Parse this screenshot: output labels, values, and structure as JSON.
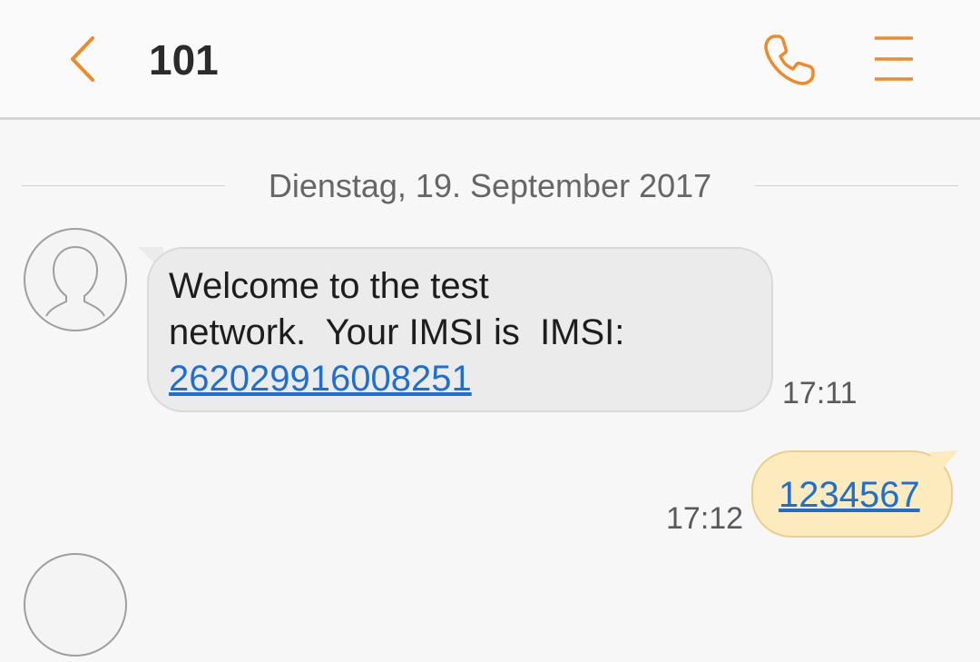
{
  "header": {
    "title": "101",
    "back_icon": "chevron-left-icon",
    "call_icon": "phone-icon",
    "menu_icon": "menu-icon",
    "accent_color": "#ef8a2b"
  },
  "conversation": {
    "date_divider": "Dienstag, 19. September 2017",
    "messages": [
      {
        "direction": "incoming",
        "text": "Welcome to the test\nnetwork.  Your IMSI is  IMSI:",
        "link": "262029916008251",
        "time": "17:11",
        "bubble_color": "#ebebeb"
      },
      {
        "direction": "outgoing",
        "link": "1234567",
        "time": "17:12",
        "bubble_color": "#fdebbd"
      }
    ]
  }
}
